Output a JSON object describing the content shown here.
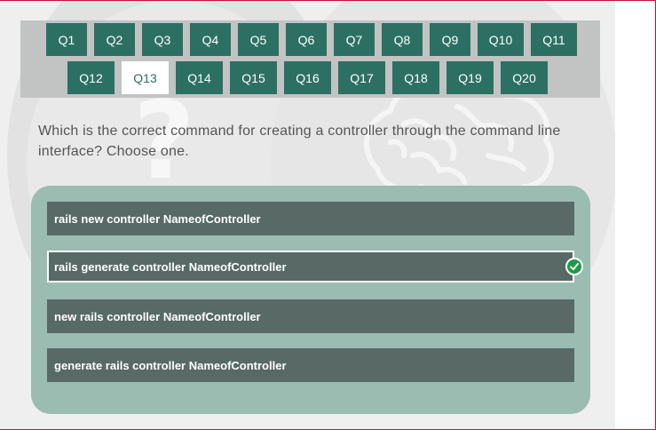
{
  "questions_nav": {
    "row1": [
      "Q1",
      "Q2",
      "Q3",
      "Q4",
      "Q5",
      "Q6",
      "Q7",
      "Q8",
      "Q9",
      "Q10",
      "Q11"
    ],
    "row2": [
      "Q12",
      "Q13",
      "Q14",
      "Q15",
      "Q16",
      "Q17",
      "Q18",
      "Q19",
      "Q20"
    ],
    "active": "Q13"
  },
  "question": {
    "text": "Which is the correct command for creating a controller through the command line interface? Choose one."
  },
  "answers": [
    {
      "label": "rails new controller NameofController",
      "selected": false
    },
    {
      "label": "rails generate controller NameofController",
      "selected": true
    },
    {
      "label": "new rails controller NameofController",
      "selected": false
    },
    {
      "label": "generate rails controller NameofController",
      "selected": false
    }
  ],
  "colors": {
    "teal": "#2c7063",
    "answer_bg": "#586966",
    "panel_bg": "#9bbcb1",
    "check_green": "#1e9b47"
  },
  "icons": {
    "selected_answer": "check-circle-icon",
    "background_left": "question-mark-icon",
    "background_right": "brain-icon"
  }
}
